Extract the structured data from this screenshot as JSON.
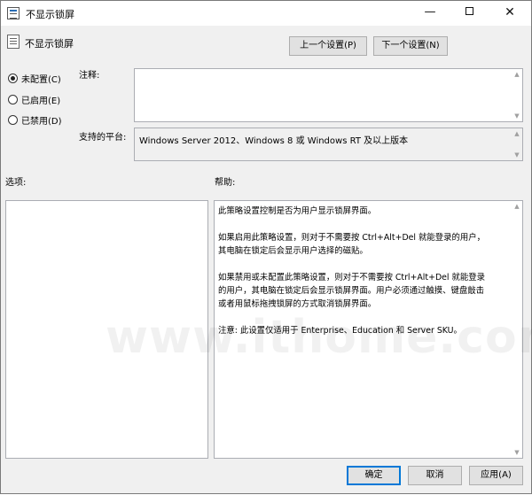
{
  "window": {
    "title": "不显示锁屏",
    "minimize_glyph": "—",
    "close_glyph": "✕"
  },
  "setting": {
    "name": "不显示锁屏"
  },
  "nav": {
    "prev_label": "上一个设置(P)",
    "next_label": "下一个设置(N)"
  },
  "state": {
    "options": [
      {
        "label": "未配置(C)",
        "checked": true
      },
      {
        "label": "已启用(E)",
        "checked": false
      },
      {
        "label": "已禁用(D)",
        "checked": false
      }
    ]
  },
  "labels": {
    "comment": "注释:",
    "platform": "支持的平台:",
    "options": "选项:",
    "help": "帮助:"
  },
  "platform_text": "Windows Server 2012、Windows 8 或 Windows RT 及以上版本",
  "help": {
    "paragraphs": [
      {
        "lines": [
          "此策略设置控制是否为用户显示锁屏界面。"
        ]
      },
      {
        "lines": [
          "如果启用此策略设置，则对于不需要按 Ctrl+Alt+Del 就能登录的用户，",
          "其电脑在锁定后会显示用户选择的磁贴。"
        ]
      },
      {
        "lines": [
          "如果禁用或未配置此策略设置，则对于不需要按 Ctrl+Alt+Del 就能登录",
          "的用户，其电脑在锁定后会显示锁屏界面。用户必须通过触摸、键盘敲击",
          "或者用鼠标拖拽锁屏的方式取消锁屏界面。"
        ]
      },
      {
        "lines": [
          "注意: 此设置仅适用于 Enterprise、Education 和 Server SKU。"
        ]
      }
    ]
  },
  "buttons": {
    "ok": "确定",
    "cancel": "取消",
    "apply": "应用(A)"
  },
  "watermark": {
    "text": "www.ithome.com"
  }
}
